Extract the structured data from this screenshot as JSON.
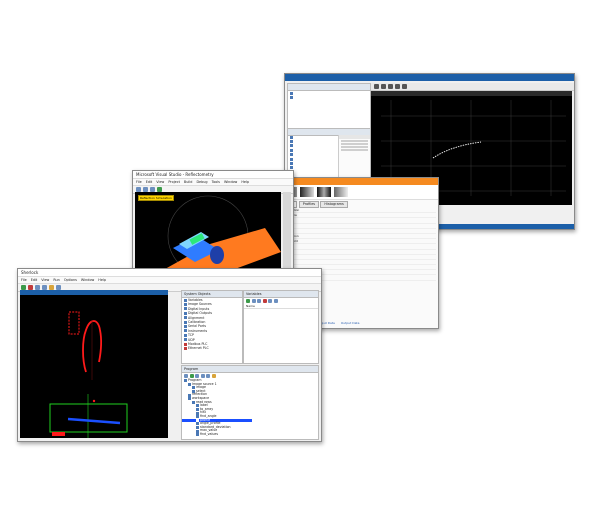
{
  "monitor_window": {
    "title": "",
    "canvas_header": "",
    "left_panel_title": "",
    "left_panel_sections": [
      "",
      ""
    ],
    "tree_items": [
      "",
      "",
      "",
      "",
      "",
      "",
      "",
      "",
      "",
      "",
      ""
    ]
  },
  "cad_window": {
    "title": "Microsoft Visual Studio - Reflectometry",
    "viewport_label": "Reflection Simulation",
    "menu_items": [
      "File",
      "Edit",
      "View",
      "Project",
      "Build",
      "Debug",
      "Tools",
      "Window",
      "Help"
    ]
  },
  "camera_window": {
    "title": "",
    "tabs": [
      "Calib",
      "Profiles",
      "Histograms"
    ],
    "rows": [
      "Calibration",
      "Exposure",
      "Gain",
      "Offset",
      "Frames",
      "Resolution",
      "Threshold",
      "Filter",
      "Mode",
      "Trigger",
      "Sensor",
      "Temp",
      "Status",
      "Result"
    ],
    "bottom_links": [
      "Input Data",
      "Output Data"
    ]
  },
  "vision_window": {
    "title": "Sherlock",
    "menu_items": [
      "File",
      "Edit",
      "View",
      "Run",
      "Options",
      "Window",
      "Help"
    ],
    "canvas_label": "",
    "label_left": "",
    "label_right": "",
    "btn_label": "",
    "sysobj_header": "System Objects",
    "sysobj_items": [
      "Variables",
      "Image Sources",
      "Digital Inputs",
      "Digital Outputs",
      "Alignment",
      "Calibration",
      "Serial Ports",
      "Instruments",
      "TCP",
      "UDP",
      "Modbus PLC",
      "Ethernet PLC"
    ],
    "vars_header": "Variables",
    "vars_col": "Name",
    "program_header": "Program",
    "program_items": [
      "Program",
      "Image source 1",
      "image",
      "select",
      "reflection",
      "workspace",
      "read rows",
      "label",
      "to_array",
      "hist",
      "find_angle",
      "profile",
      "angle_profile",
      "standard_deviation",
      "max_value",
      "find_values"
    ]
  },
  "colors": {
    "accent": "#1c5fa8",
    "canvas": "#000000",
    "cad_orange": "#ff7a1f",
    "cad_blue": "#2f7cff",
    "trace_red": "#ff1a1a",
    "roi_green": "#1fd11f",
    "highlight_blue": "#1a4fff"
  }
}
